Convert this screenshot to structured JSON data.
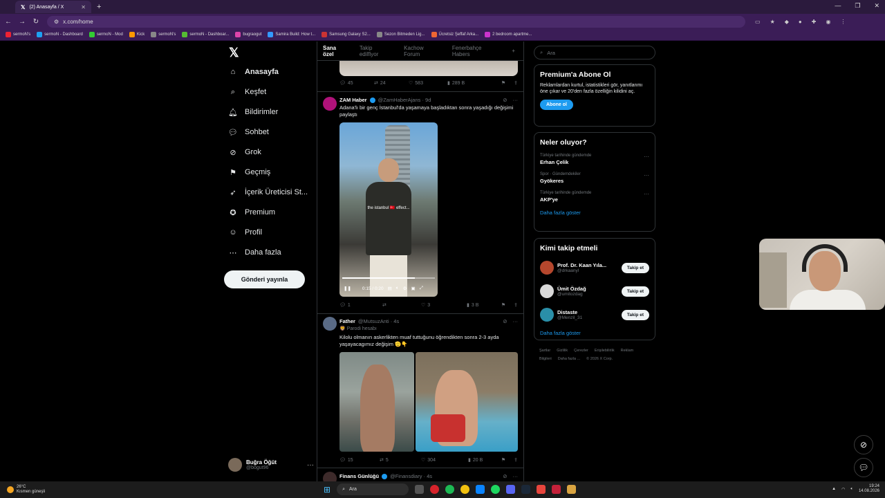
{
  "browser": {
    "tab_title": "(2) Anasayfa / X",
    "url": "x.com/home",
    "bookmarks": [
      "sermoN's",
      "sermoN - Dashboard",
      "sermoN - Mod",
      "Kick",
      "sermoN's",
      "sermoN - Dashboar...",
      "bugraogut",
      "Samira Build: How t...",
      "Samsung Galaxy S2...",
      "Sezon Bitmeden Lig...",
      "Ücretsiz Şeffaf Arka...",
      "2 bedroom apartme..."
    ]
  },
  "nav": {
    "items": [
      {
        "label": "Anasayfa",
        "icon": "home-icon"
      },
      {
        "label": "Keşfet",
        "icon": "search-icon"
      },
      {
        "label": "Bildirimler",
        "icon": "bell-icon"
      },
      {
        "label": "Sohbet",
        "icon": "chat-icon"
      },
      {
        "label": "Grok",
        "icon": "grok-icon"
      },
      {
        "label": "Geçmiş",
        "icon": "bookmark-icon"
      },
      {
        "label": "İçerik Üreticisi St...",
        "icon": "rocket-icon"
      },
      {
        "label": "Premium",
        "icon": "verified-icon"
      },
      {
        "label": "Profil",
        "icon": "person-icon"
      },
      {
        "label": "Daha fazla",
        "icon": "more-circle-icon"
      }
    ],
    "post_button": "Gönderi yayınla",
    "user": {
      "name": "Buğra Öğüt",
      "handle": "@bogut96"
    }
  },
  "timeline": {
    "tabs": [
      "Sana özel",
      "Takip edilfiyor",
      "Kachow Forum",
      "Fenerbahçe Habers"
    ],
    "top_stats": {
      "replies": "45",
      "reposts": "24",
      "likes": "583",
      "views": "289 B"
    },
    "tweets": [
      {
        "name": "ZAM Haber",
        "handle": "@ZamHaberAjans · 9d",
        "text": "Adana'lı bir genç İstanbul'da yaşamaya başladıktan sonra yaşadığı değişimi paylaştı",
        "video_caption": "the istanbul 🇹🇷 effect...",
        "video_time": "0:15 / 0:20",
        "video_progress": 0.78,
        "stats": {
          "replies": "1",
          "reposts": "",
          "likes": "3",
          "views": "3 B"
        }
      },
      {
        "name": "Father",
        "handle": "@MutsuzAnti · 4s",
        "label": "🦁 Parodi hesabı",
        "text": "Kilolu olmanın askerlikten muaf tuttuğunu öğrendikten sonra 2-3 ayda yaşayacagımız değişim 🫡👇",
        "stats": {
          "replies": "15",
          "reposts": "5",
          "likes": "304",
          "views": "20 B"
        }
      },
      {
        "name": "Finans Günlüğü",
        "handle": "@Finansdiary · 4s"
      }
    ]
  },
  "right": {
    "search_placeholder": "Ara",
    "premium": {
      "title": "Premium'a Abone Ol",
      "text": "Reklamlardan kurtul, istatistikleri gör, yanıtlanmı öne çıkar ve 20'den fazla özelliğin kilidini aç.",
      "button": "Abone ol"
    },
    "trends": {
      "title": "Neler oluyor?",
      "items": [
        {
          "meta": "Türkiye tarihinde gündemde",
          "topic": "Erhan Çelik"
        },
        {
          "meta": "Spor · Gündemdekiler",
          "topic": "Gyökeres"
        },
        {
          "meta": "Türkiye tarihinde gündemde",
          "topic": "AKP'ye"
        }
      ],
      "show_more": "Daha fazla göster"
    },
    "who_to_follow": {
      "title": "Kimi takip etmeli",
      "items": [
        {
          "name": "Prof. Dr. Kaan Yıla...",
          "handle": "@drkaanyl",
          "button": "Takip et",
          "color": "#b5472d"
        },
        {
          "name": "Ümit Özdağ",
          "handle": "@umitozdag",
          "button": "Takip et",
          "color": "#d9d9d9"
        },
        {
          "name": "Distaste",
          "handle": "@Menzil_31",
          "button": "Takip et",
          "color": "#2a8fa8"
        }
      ],
      "show_more": "Daha fazla göster"
    },
    "footer": [
      "Şartlar",
      "Gizlilik",
      "Çerezler",
      "Erişilebilirlik",
      "Reklam Bilgileri",
      "Daha fazla ...",
      "© 2026 X Corp."
    ]
  },
  "taskbar": {
    "weather_temp": "26°C",
    "weather_desc": "Kısmen güneşli",
    "search": "Ara",
    "time": "19:24",
    "date": "14.08.2026"
  },
  "colors": {
    "accent": "#1d9bf0",
    "browser": "#3b1d57"
  }
}
